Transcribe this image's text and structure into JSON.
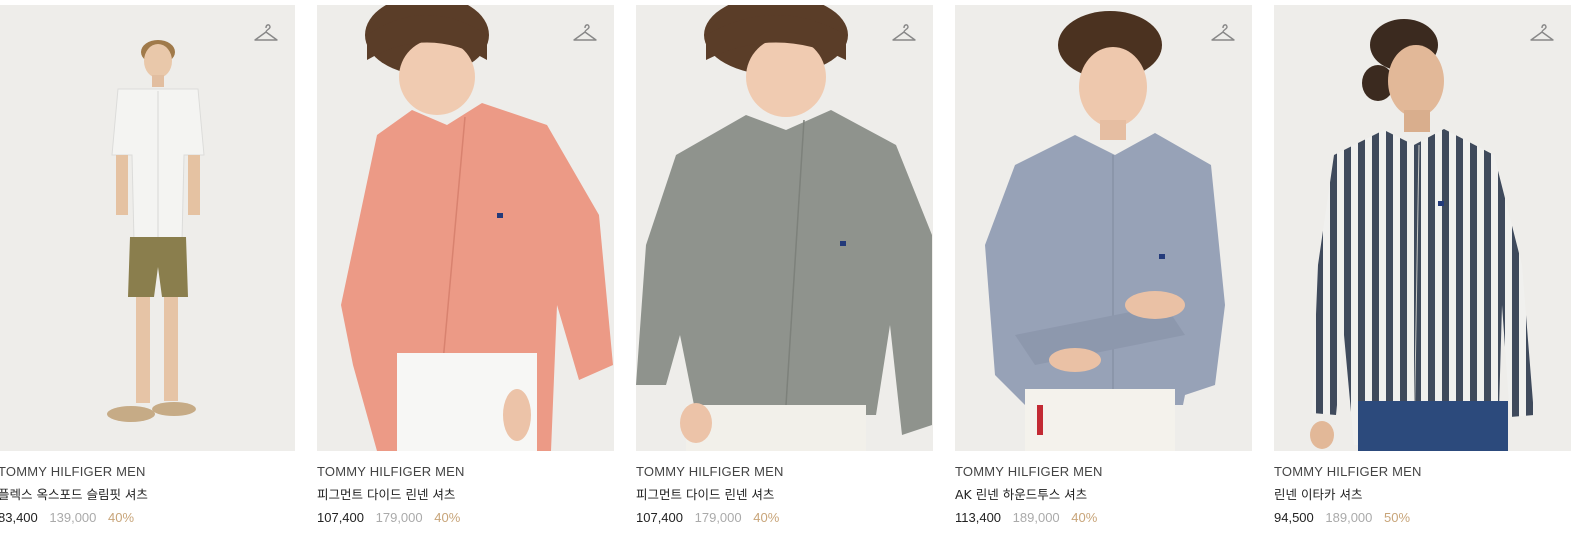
{
  "products": [
    {
      "brand": "TOMMY HILFIGER MEN",
      "name": "플렉스 옥스포드 슬림핏 셔츠",
      "price": "83,400",
      "original_price": "139,000",
      "discount": "40%",
      "shirt_color": "#f4f4f2",
      "wishlist_icon": "hanger-icon"
    },
    {
      "brand": "TOMMY HILFIGER MEN",
      "name": "피그먼트 다이드 린넨 셔츠",
      "price": "107,400",
      "original_price": "179,000",
      "discount": "40%",
      "shirt_color": "#ec9a86",
      "wishlist_icon": "hanger-icon"
    },
    {
      "brand": "TOMMY HILFIGER MEN",
      "name": "피그먼트 다이드 린넨 셔츠",
      "price": "107,400",
      "original_price": "179,000",
      "discount": "40%",
      "shirt_color": "#8f938d",
      "wishlist_icon": "hanger-icon"
    },
    {
      "brand": "TOMMY HILFIGER MEN",
      "name": "AK 린넨 하운드투스 셔츠",
      "price": "113,400",
      "original_price": "189,000",
      "discount": "40%",
      "shirt_color": "#97a2b7",
      "wishlist_icon": "hanger-icon"
    },
    {
      "brand": "TOMMY HILFIGER MEN",
      "name": "린넨 이타카 셔츠",
      "price": "94,500",
      "original_price": "189,000",
      "discount": "50%",
      "shirt_color": "#3f4a5c",
      "wishlist_icon": "hanger-icon"
    }
  ],
  "colors": {
    "discount": "#c8a57a",
    "original_price": "#aaaaaa",
    "photo_background": "#eeedea"
  }
}
